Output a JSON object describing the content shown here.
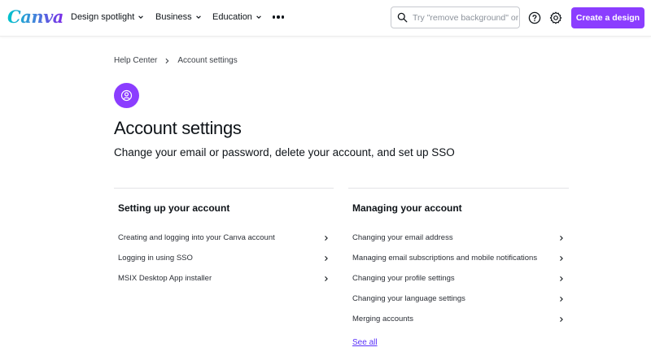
{
  "header": {
    "logo": "Canva",
    "nav": [
      "Design spotlight",
      "Business",
      "Education"
    ],
    "search_placeholder": "Try \"remove background\" or \"brochure\"",
    "cta_label": "Create a design"
  },
  "breadcrumb": {
    "home": "Help Center",
    "current": "Account settings"
  },
  "page": {
    "title": "Account settings",
    "subtitle": "Change your email or password, delete your account, and set up SSO"
  },
  "sections": [
    {
      "heading": "Setting up your account",
      "links": [
        "Creating and logging into your Canva account",
        "Logging in using SSO",
        "MSIX Desktop App installer"
      ]
    },
    {
      "heading": "Managing your account",
      "links": [
        "Changing your email address",
        "Managing email subscriptions and mobile notifications",
        "Changing your profile settings",
        "Changing your language settings",
        "Merging accounts"
      ],
      "see_all": "See all"
    }
  ],
  "colors": {
    "accent": "#8b3dff",
    "link": "#5a32fa",
    "text": "#0e1318"
  }
}
